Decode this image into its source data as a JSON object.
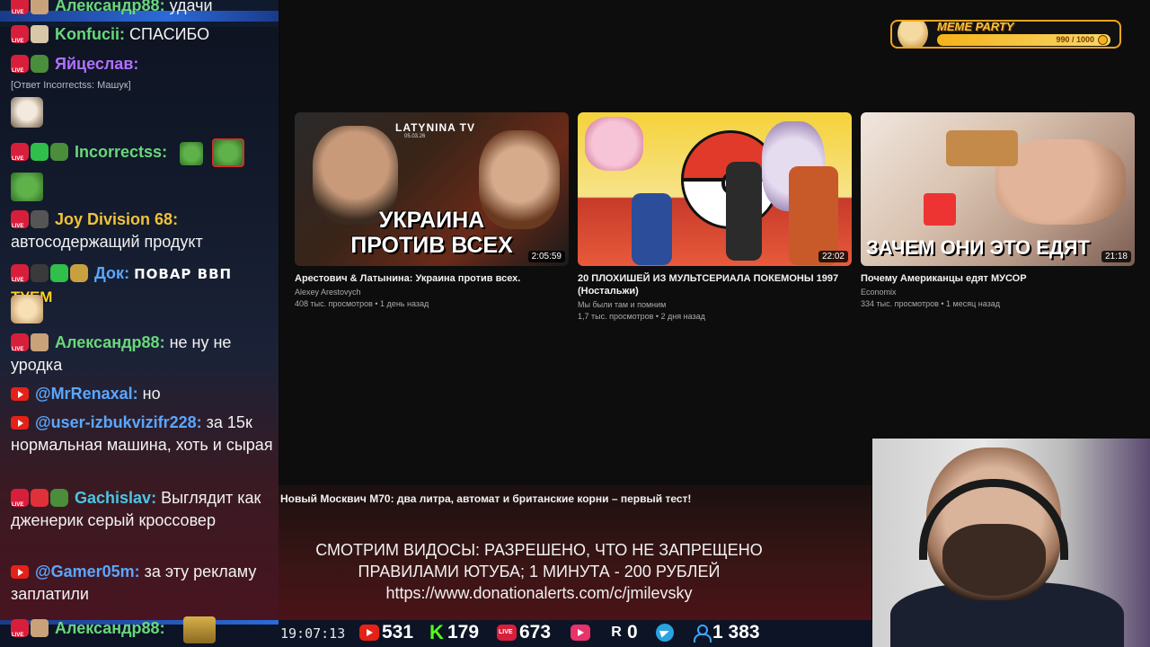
{
  "chat": {
    "messages": [
      {
        "name": "Александр88",
        "text": "удачи"
      },
      {
        "name": "Konfucii",
        "text": "СПАСИБО"
      },
      {
        "name": "Яйцеслав",
        "text": ""
      },
      {
        "reply": "[Ответ Incorrectss: Машук]"
      },
      {
        "name": "Incorrectss",
        "text": ""
      },
      {
        "name": "Joy Division 68",
        "text": "автосодержащий продукт"
      },
      {
        "name": "Док",
        "text": "ПОВАР ВВП",
        "extra": "ТУЕМ"
      },
      {
        "name": "Александр88",
        "text": "не ну не уродка"
      },
      {
        "name": "@MrRenaxal",
        "text": "но"
      },
      {
        "name": "@user-izbukvizifr228",
        "text": "за 15к нормальная машина, хоть и сырая"
      },
      {
        "name": "Gachislav",
        "text": "Выглядит как дженерик серый кроссовер"
      },
      {
        "name": "@Gamer05m",
        "text": "за эту рекламу заплатили"
      },
      {
        "name": "Александр88",
        "text": ""
      }
    ]
  },
  "meme_party": {
    "label": "MEME PARTY",
    "count": "990 / 1000"
  },
  "videos": [
    {
      "title": "Арестович & Латынина: Украина против всех.",
      "channel": "Alexey Arestovych",
      "meta": "408 тыс. просмотров • 1 день назад",
      "duration": "2:05:59",
      "thumb_text": "УКРАИНА ПРОТИВ ВСЕХ",
      "thumb_brand": "LATYNINA TV",
      "thumb_date": "05.03.26"
    },
    {
      "title": "20 ПЛОХИШЕЙ ИЗ МУЛЬТСЕРИАЛА ПОКЕМОНЫ 1997 (Ностальжи)",
      "channel": "Мы были там и помним",
      "meta": "1,7 тыс. просмотров • 2 дня назад",
      "duration": "22:02"
    },
    {
      "title": "Почему Американцы едят МУСОР",
      "channel": "Economix",
      "meta": "334 тыс. просмотров • 1 месяц назад",
      "duration": "21:18",
      "thumb_text": "ЗАЧЕМ ОНИ ЭТО ЕДЯТ"
    }
  ],
  "next_video_title": "Новый Москвич М70: два литра, автомат и британские корни – первый тест!",
  "rules": {
    "line1": "СМОТРИМ ВИДОСЫ: РАЗРЕШЕНО, ЧТО НЕ ЗАПРЕЩЕНО",
    "line2": "ПРАВИЛАМИ ЮТУБА; 1 МИНУТА - 200 РУБЛЕЙ",
    "line3": "https://www.donationalerts.com/c/jmilevsky"
  },
  "status": {
    "time": "19:07:13",
    "youtube": "531",
    "kick": "179",
    "kick_icon": "K",
    "live": "673",
    "rutube": "0",
    "rutube_icon": "R",
    "total": "1 383"
  }
}
